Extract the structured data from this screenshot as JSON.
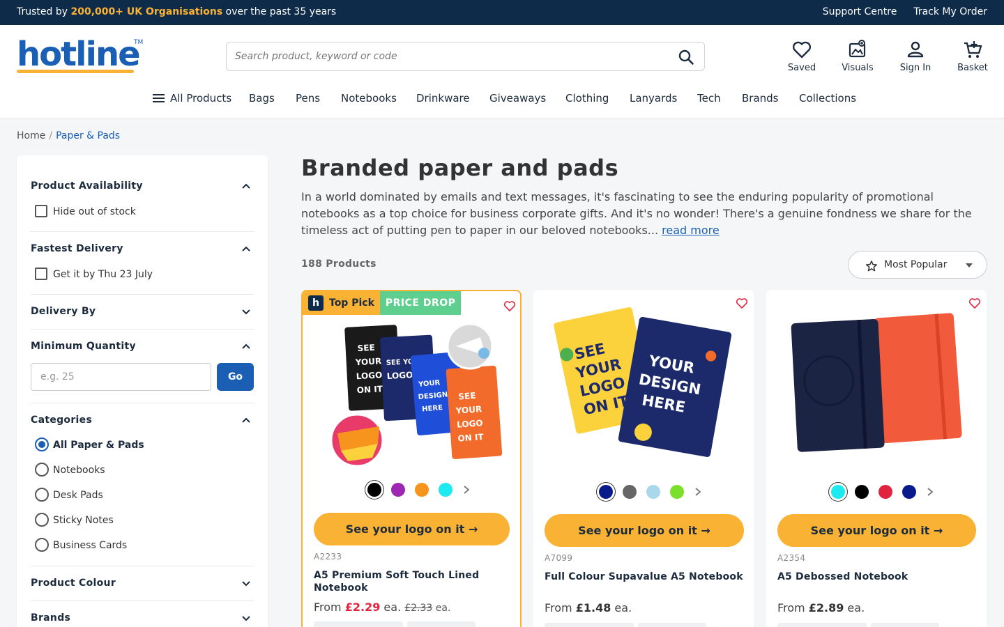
{
  "topbar": {
    "trust_prefix": "Trusted by ",
    "trust_highlight": "200,000+ UK Organisations",
    "trust_suffix": " over the past 35 years",
    "support": "Support Centre",
    "track": "Track My Order"
  },
  "header": {
    "logo": "hotline",
    "logo_tm": "TM",
    "search_placeholder": "Search product, keyword or code",
    "icons": [
      {
        "label": "Saved",
        "icon": "heart-icon"
      },
      {
        "label": "Visuals",
        "icon": "visuals-icon"
      },
      {
        "label": "Sign In",
        "icon": "user-icon"
      },
      {
        "label": "Basket",
        "icon": "basket-icon"
      }
    ]
  },
  "nav": {
    "items": [
      "All Products",
      "Bags",
      "Pens",
      "Notebooks",
      "Drinkware",
      "Giveaways",
      "Clothing",
      "Lanyards",
      "Tech",
      "Brands",
      "Collections"
    ]
  },
  "breadcrumb": {
    "home": "Home",
    "current": "Paper & Pads"
  },
  "filters": {
    "availability": {
      "title": "Product Availability",
      "option": "Hide out of stock"
    },
    "fastest": {
      "title": "Fastest Delivery",
      "option": "Get it by Thu 23 July"
    },
    "delivery_by": {
      "title": "Delivery By"
    },
    "min_qty": {
      "title": "Minimum Quantity",
      "placeholder": "e.g. 25",
      "go": "Go"
    },
    "categories": {
      "title": "Categories",
      "options": [
        "All Paper & Pads",
        "Notebooks",
        "Desk Pads",
        "Sticky Notes",
        "Business Cards"
      ],
      "selected": "All Paper & Pads"
    },
    "colour": {
      "title": "Product Colour"
    },
    "brands": {
      "title": "Brands"
    }
  },
  "main": {
    "title": "Branded paper and pads",
    "intro": "In a world dominated by emails and text messages, it's fascinating to see the enduring popularity of promotional notebooks as a top choice for business corporate gifts. And it's no wonder! There's a genuine fondness we share for the timeless act of putting pen to paper in our beloved notebooks... ",
    "read_more": "read more",
    "count": "188 Products",
    "sort": "Most Popular"
  },
  "products": [
    {
      "badge_top": "Top Pick",
      "badge_drop": "PRICE DROP",
      "colours": [
        "#000000",
        "#9c27b0",
        "#f7941d",
        "#1de9f0"
      ],
      "cta": "See your logo on it",
      "sku": "A2233",
      "name": "A5 Premium Soft Touch Lined Notebook",
      "from": "From ",
      "price": "£2.29",
      "ea": " ea. ",
      "was": "£2.33",
      "ea2": " ea."
    },
    {
      "colours": [
        "#0a1a8a",
        "#666666",
        "#a8d8ea",
        "#7be02a"
      ],
      "cta": "See your logo on it",
      "sku": "A7099",
      "name": "Full Colour Supavalue A5 Notebook",
      "from": "From ",
      "price": "£1.48",
      "ea": " ea."
    },
    {
      "colours": [
        "#1de9f0",
        "#000000",
        "#e0243f",
        "#0a1a8a"
      ],
      "cta": "See your logo on it",
      "sku": "A2354",
      "name": "A5 Debossed Notebook",
      "from": "From ",
      "price": "£2.89",
      "ea": " ea."
    }
  ],
  "colors": {
    "navy": "#0f2b4a",
    "accent": "#f9b233",
    "blue": "#1a5fb4",
    "sale": "#e0243f",
    "drop": "#5fcf8f"
  }
}
